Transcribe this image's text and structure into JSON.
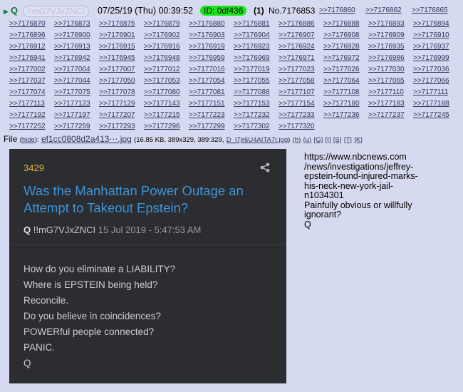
{
  "header": {
    "arrow": "▶",
    "name": "Q",
    "tripcode": "!!mG7VJxZNCI",
    "datetime": "07/25/19 (Thu) 00:39:52",
    "id_label": "ID: 0df436",
    "post_count": "(1)",
    "post_number": "No.7176853",
    "links": [
      ">>7176860",
      ">>7176862",
      ">>7176865"
    ]
  },
  "backlinks": [
    [
      ">>7176870",
      ">>7176873",
      ">>7176875",
      ">>7176879",
      ">>7176880",
      ">>7176881",
      ">>7176886",
      ">>7176888",
      ">>7176893",
      ">>7176894"
    ],
    [
      ">>7176896",
      ">>7176900",
      ">>7176901",
      ">>7176902",
      ">>7176903",
      ">>7176904",
      ">>7176907",
      ">>7176908",
      ">>7176909",
      ">>7176910"
    ],
    [
      ">>7176912",
      ">>7176913",
      ">>7176915",
      ">>7176916",
      ">>7176919",
      ">>7176923",
      ">>7176924",
      ">>7176928",
      ">>7176935",
      ">>7176937"
    ],
    [
      ">>7176941",
      ">>7176942",
      ">>7176945",
      ">>7176948",
      ">>7176959",
      ">>7176969",
      ">>7176971",
      ">>7176972",
      ">>7176986",
      ">>7176999"
    ],
    [
      ">>7177002",
      ">>7177004",
      ">>7177007",
      ">>7177012",
      ">>7177016",
      ">>7177019",
      ">>7177023",
      ">>7177026",
      ">>7177030",
      ">>7177036"
    ],
    [
      ">>7177037",
      ">>7177044",
      ">>7177050",
      ">>7177053",
      ">>7177054",
      ">>7177055",
      ">>7177058",
      ">>7177064",
      ">>7177065",
      ">>7177066"
    ],
    [
      ">>7177074",
      ">>7177075",
      ">>7177078",
      ">>7177080",
      ">>7177081",
      ">>7177088",
      ">>7177107",
      ">>7177108",
      ">>7177110",
      ">>7177111"
    ],
    [
      ">>7177113",
      ">>7177123",
      ">>7177129",
      ">>7177143",
      ">>7177151",
      ">>7177153",
      ">>7177154",
      ">>7177180",
      ">>7177183",
      ">>7177188"
    ],
    [
      ">>7177192",
      ">>7177197",
      ">>7177207",
      ">>7177215",
      ">>7177223",
      ">>7177232",
      ">>7177233",
      ">>7177236",
      ">>7177237",
      ">>7177245"
    ],
    [
      ">>7177252",
      ">>7177259",
      ">>7177293",
      ">>7177296",
      ">>7177299",
      ">>7177302",
      ">>7177320"
    ]
  ],
  "file": {
    "label": "File",
    "hide_open": "(",
    "hide": "hide",
    "hide_close": "):",
    "filename": "ef1cc0808d2a413⋯.jpg",
    "meta": "(16.85 KB, 389x329, 389:329,",
    "orig_name": "D_I7jr6U4AITA7r.jpg",
    "meta_close": ")",
    "tools": [
      "(h)",
      "(u)",
      "[G]",
      "[I]",
      "[S]",
      "[T]",
      "[K]"
    ]
  },
  "card": {
    "number": "3429",
    "share_icon": "share-icon",
    "title": "Was the Manhattan Power Outage an Attempt to Takeout Epstein?",
    "author_name": "Q",
    "author_trip": "!!mG7VJxZNCI",
    "date": "15 Jul 2019 - 5:47:53 AM",
    "body": [
      "How do you eliminate a LIABILITY?",
      "Where is EPSTEIN being held?",
      "Reconcile.",
      "Do you believe in coincidences?",
      "POWERful people connected?",
      "PANIC.",
      "Q"
    ],
    "colors": {
      "background": "#2b2d31",
      "title": "#3e94d6",
      "number": "#e0b33c"
    }
  },
  "post_text": [
    "https://www.nbcnews.com",
    "/news/investigations/jeffrey-",
    "epstein-found-injured-marks-",
    "his-neck-new-york-jail-",
    "n1034301",
    "Painfully obvious or willfully",
    "ignorant?",
    "Q"
  ],
  "colors": {
    "page_bg": "#d6daf0",
    "link": "#34345c",
    "name": "#117743",
    "id_badge": "#19e619"
  }
}
